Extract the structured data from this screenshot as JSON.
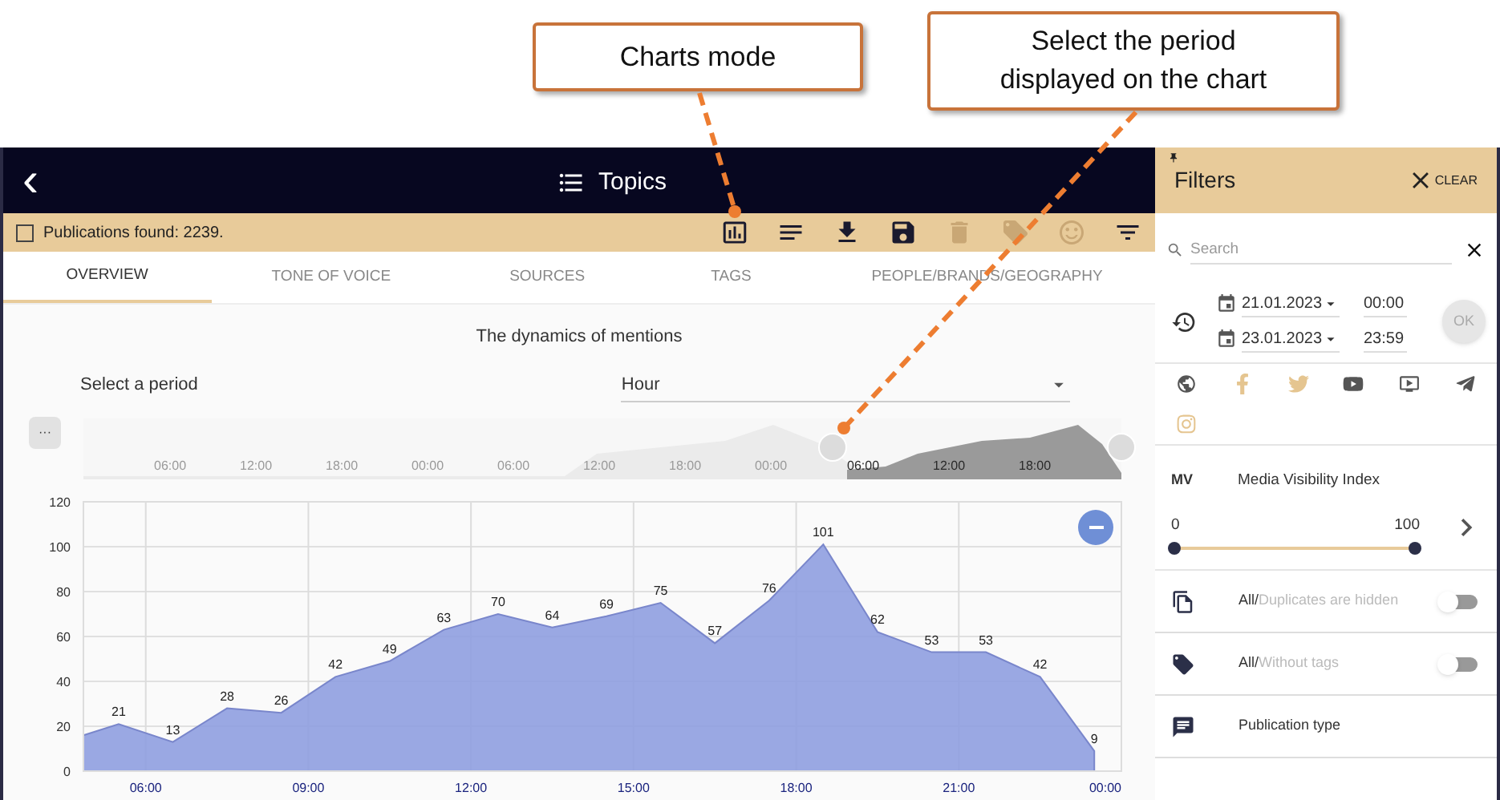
{
  "callouts": [
    {
      "text": "Charts mode"
    },
    {
      "text": "Select the period displayed on the chart"
    }
  ],
  "header": {
    "back": "‹",
    "title": "Topics"
  },
  "toolbar": {
    "select_all": {
      "checked": false
    },
    "count_text": "Publications found: 2239.",
    "icons": [
      {
        "kind": "chart",
        "disabled": false
      },
      {
        "kind": "list",
        "disabled": false
      },
      {
        "kind": "download",
        "disabled": false
      },
      {
        "kind": "save",
        "disabled": false
      },
      {
        "kind": "delete",
        "disabled": true
      },
      {
        "kind": "tag",
        "disabled": true
      },
      {
        "kind": "smile",
        "disabled": true
      },
      {
        "kind": "filter",
        "disabled": false
      }
    ]
  },
  "tabs": [
    {
      "label": "OVERVIEW",
      "selected": true
    },
    {
      "label": "TONE OF VOICE",
      "selected": false
    },
    {
      "label": "SOURCES",
      "selected": false
    },
    {
      "label": "TAGS",
      "selected": false
    },
    {
      "label": "PEOPLE/BRANDS/GEOGRAPHY",
      "selected": false
    }
  ],
  "chart_panel": {
    "title": "The dynamics of mentions",
    "period_label": "Select a period",
    "period_value": "Hour",
    "menu_button": "···",
    "navigator": {
      "labels": [
        "06:00",
        "12:00",
        "18:00",
        "00:00",
        "06:00",
        "12:00",
        "18:00",
        "00:00",
        "06:00",
        "12:00",
        "18:00"
      ]
    },
    "chart_data": {
      "type": "area",
      "x": [
        4.85,
        5.5,
        6.5,
        7.5,
        8.5,
        9.5,
        10.5,
        11.5,
        12.5,
        13.5,
        14.5,
        15.5,
        16.5,
        17.5,
        18.5,
        19.5,
        20.5,
        21.5,
        22.5,
        23.5
      ],
      "grid": true,
      "series": [
        {
          "color": "#8f9fe0",
          "values": [
            16,
            21,
            13,
            28,
            26,
            42,
            49,
            63,
            70,
            64,
            69,
            75,
            57,
            76,
            101,
            62,
            53,
            53,
            42,
            9
          ]
        }
      ],
      "value_labels": [
        null,
        "21",
        "13",
        "28",
        "26",
        "42",
        "49",
        "63",
        "70",
        "64",
        "69",
        "75",
        "57",
        "76",
        "101",
        "62",
        "53",
        "53",
        "42",
        "9"
      ],
      "xlim": [
        4.85,
        24
      ],
      "ylim": [
        0,
        120
      ],
      "xticks": [
        {
          "value": 6,
          "label": "06:00"
        },
        {
          "value": 9,
          "label": "09:00"
        },
        {
          "value": 12,
          "label": "12:00"
        },
        {
          "value": 15,
          "label": "15:00"
        },
        {
          "value": 18,
          "label": "18:00"
        },
        {
          "value": 21,
          "label": "21:00"
        },
        {
          "value": 24,
          "label": "00:00"
        }
      ],
      "yticks": [
        0,
        20,
        40,
        60,
        80,
        100,
        120
      ]
    }
  },
  "filters": {
    "title": "Filters",
    "clear": "CLEAR",
    "search": {
      "placeholder": "Search"
    },
    "date_from": "21.01.2023",
    "time_from": "00:00",
    "date_to": "23.01.2023",
    "time_to": "23:59",
    "ok": "OK",
    "sources": [
      {
        "kind": "web",
        "selected": true
      },
      {
        "kind": "facebook",
        "selected": false
      },
      {
        "kind": "twitter",
        "selected": false
      },
      {
        "kind": "youtube",
        "selected": true
      },
      {
        "kind": "video",
        "selected": true
      },
      {
        "kind": "telegram",
        "selected": true
      },
      {
        "kind": "instagram",
        "selected": false
      }
    ],
    "mvi": {
      "badge": "MV",
      "label": "Media Visibility Index",
      "min": "0",
      "max": "100",
      "level": 1
    },
    "toggles": [
      {
        "kind": "duplicates",
        "strong": "All/",
        "rest": "Duplicates are hidden",
        "on": false
      },
      {
        "kind": "tags",
        "strong": "All/",
        "rest": "Without tags",
        "on": false
      }
    ],
    "publication_type": "Publication type"
  }
}
